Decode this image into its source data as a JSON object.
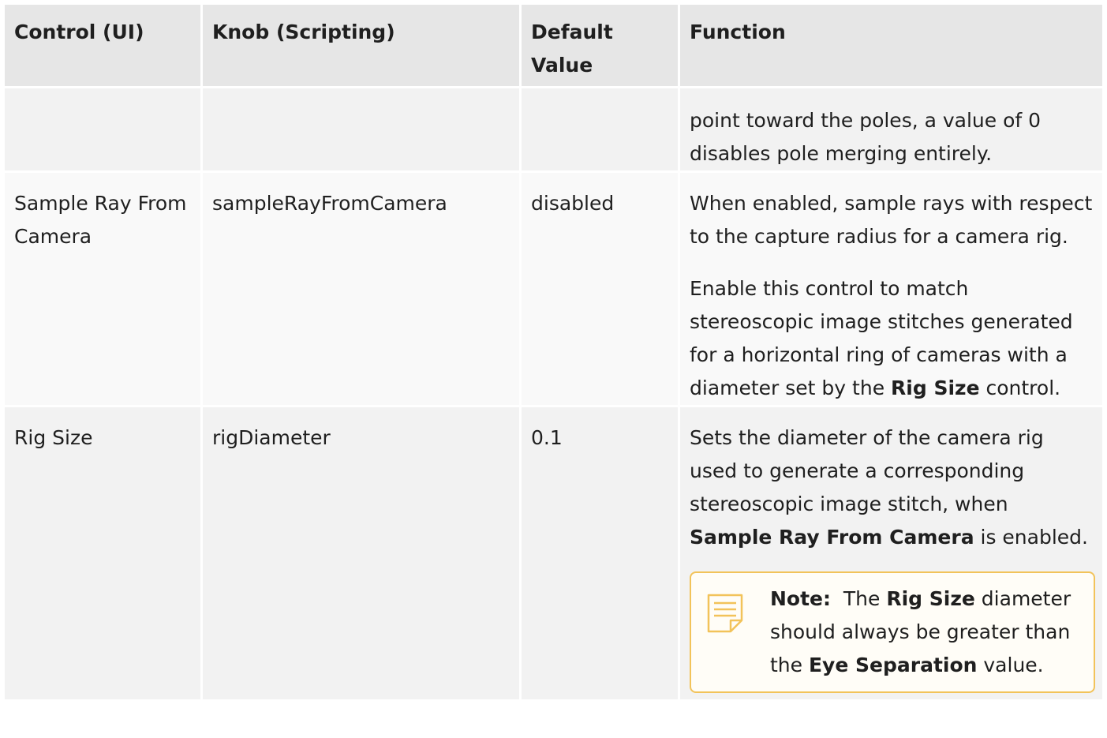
{
  "header": [
    "Control (UI)",
    "Knob (Scripting)",
    "Default Value",
    "Function"
  ],
  "row0": {
    "control": "",
    "knob": "",
    "default": "",
    "function": "point toward the poles, a value of 0 disables pole merging entirely."
  },
  "row1": {
    "control": "Sample Ray From Camera",
    "knob": "sampleRayFromCamera",
    "default": "disabled",
    "function_p1": "When enabled, sample rays with respect to the capture radius for a camera rig.",
    "function_p2_pre": "Enable this control to match stereoscopic image stitches generated for a horizontal ring of cameras with a diameter set by the ",
    "function_p2_bold": "Rig Size",
    "function_p2_post": " control."
  },
  "row2": {
    "control": "Rig Size",
    "knob": "rigDiameter",
    "default": "0.1",
    "function_pre": "Sets the diameter of the camera rig used to generate a corresponding stereoscopic image stitch, when ",
    "function_bold": "Sample Ray From Camera",
    "function_post": " is enabled.",
    "note": {
      "icon": "note-icon",
      "label": "Note:",
      "t1": "  The ",
      "b1": "Rig Size",
      "t2": " diameter should always be greater than the ",
      "b2": "Eye Separation",
      "t3": " value."
    }
  },
  "colors": {
    "header_bg": "#e6e6e6",
    "row_bg": "#f2f2f2",
    "row_alt_bg": "#f9f9f9",
    "note_border": "#f2c35a"
  }
}
